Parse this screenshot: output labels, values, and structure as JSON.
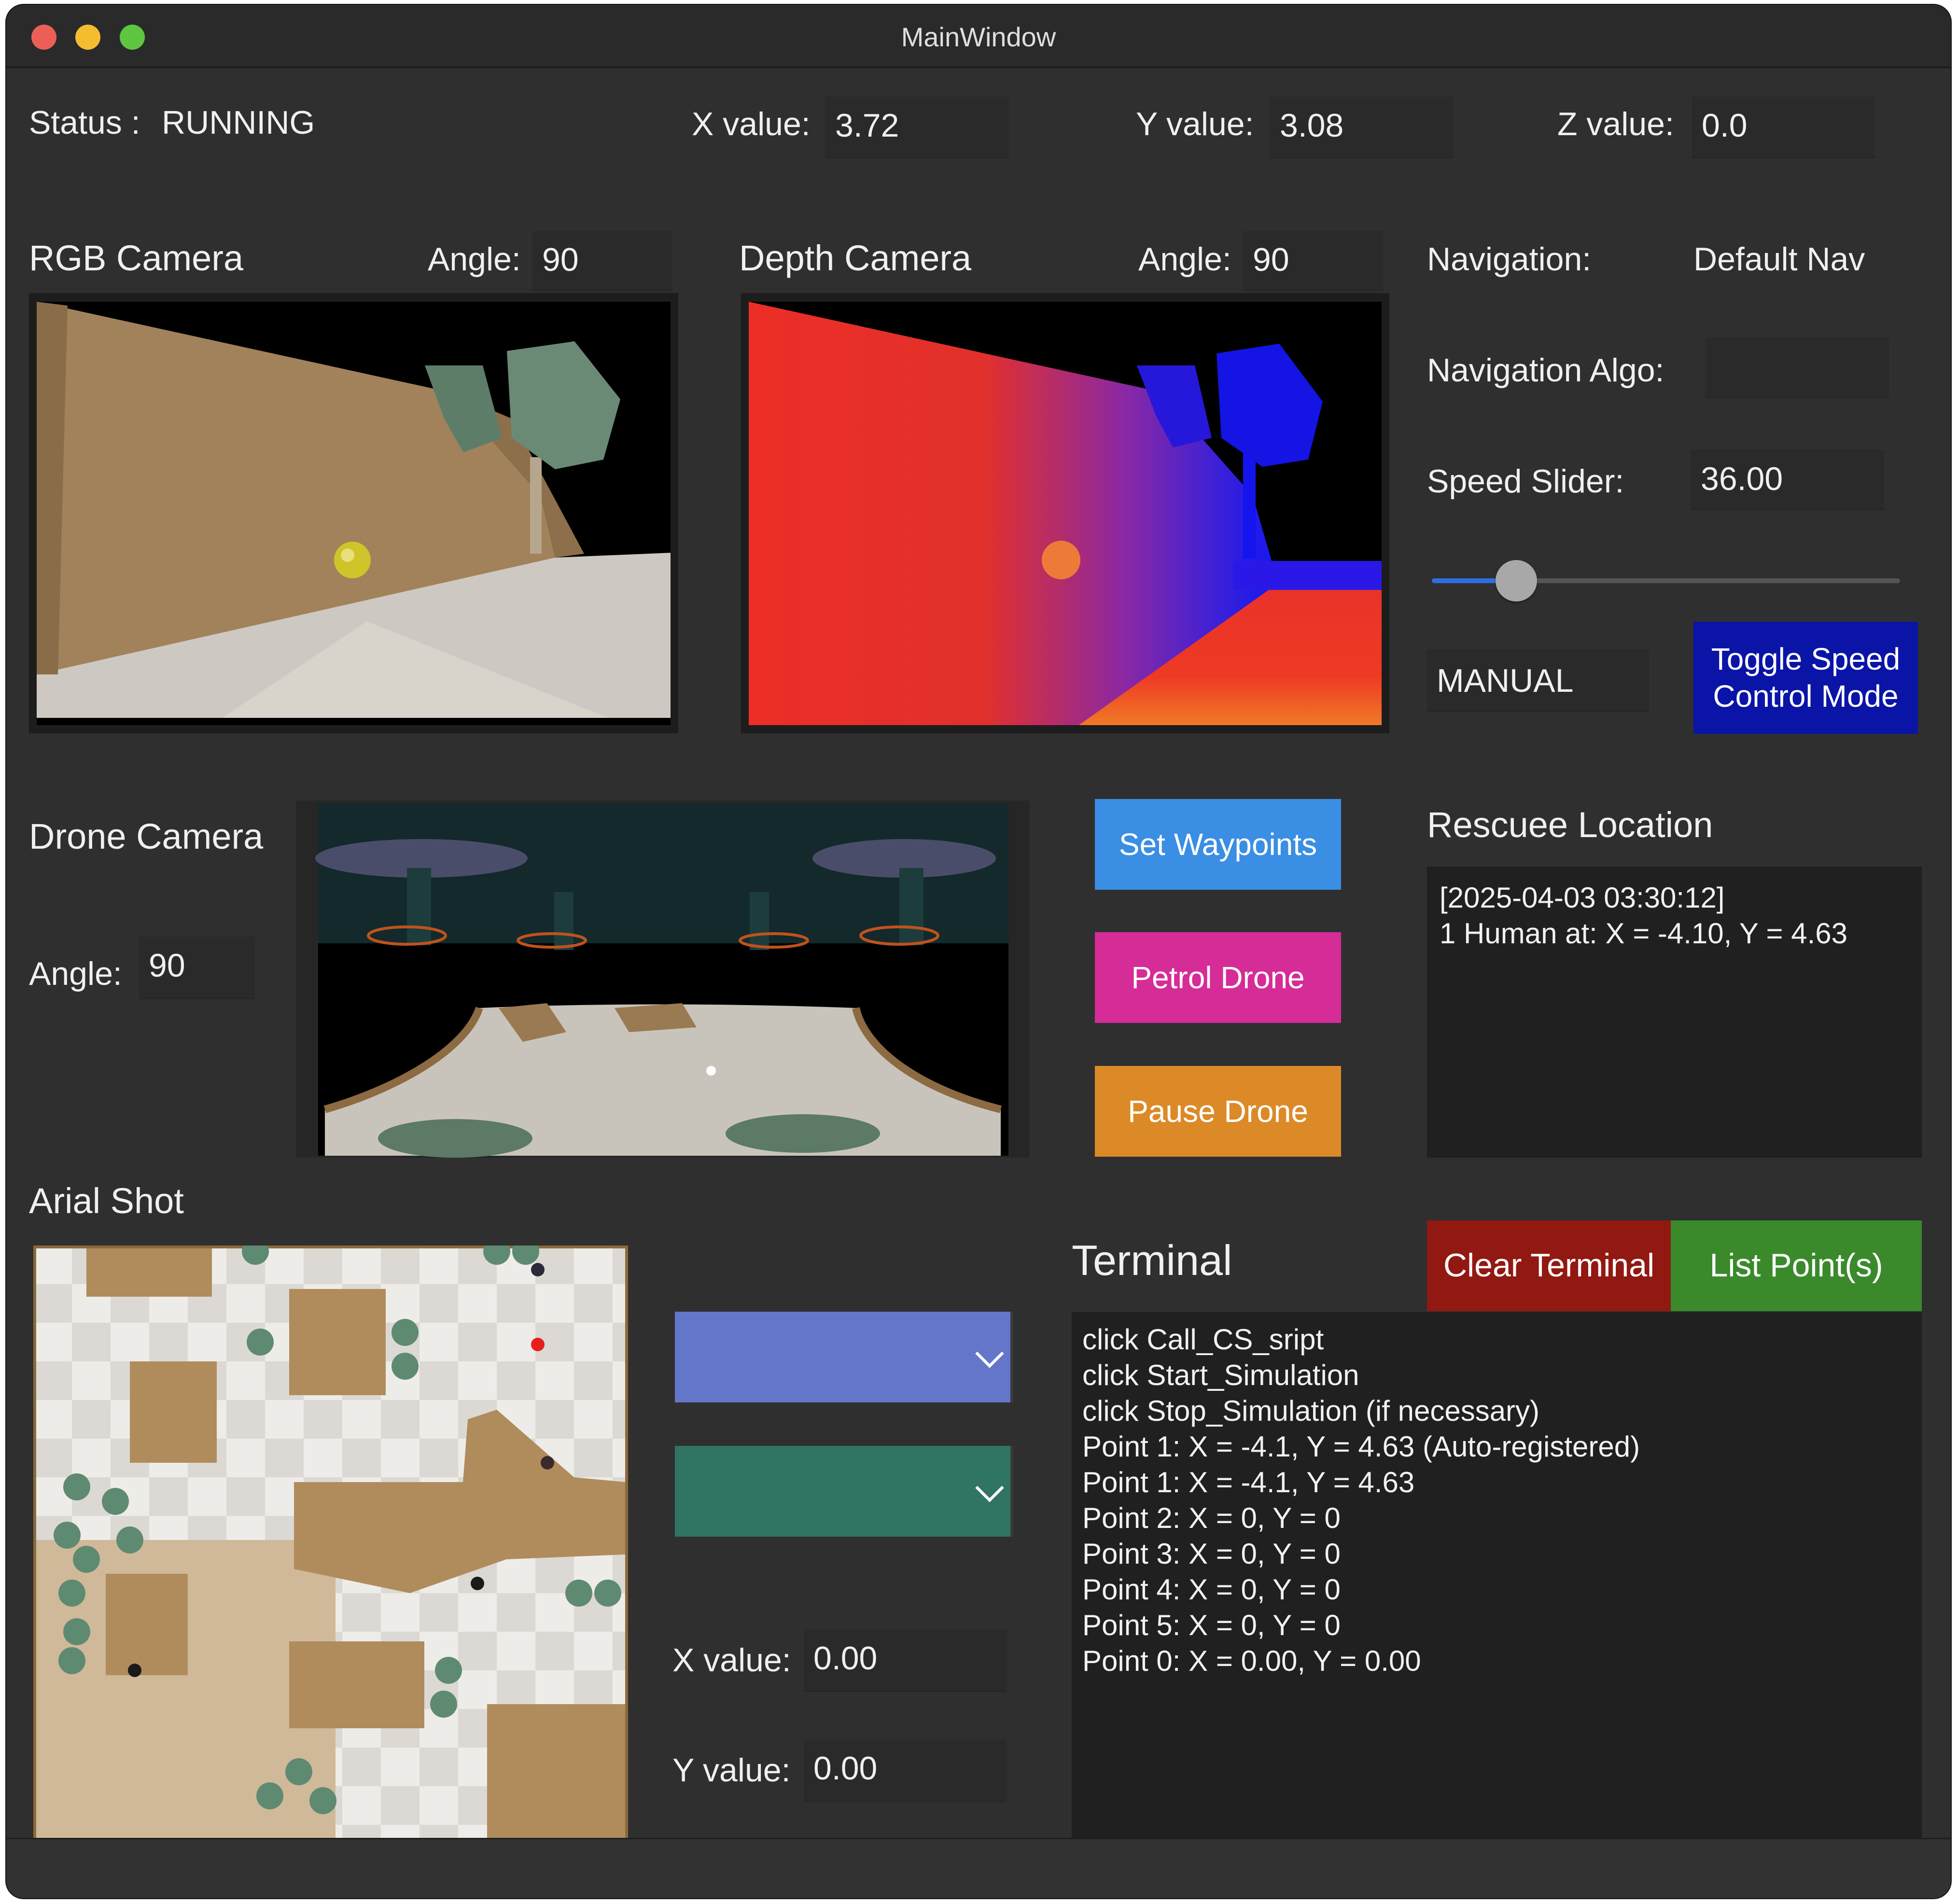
{
  "window": {
    "title": "MainWindow"
  },
  "status": {
    "label": "Status :",
    "value": "RUNNING"
  },
  "position": {
    "x_label": "X value:",
    "x_value": "3.72",
    "y_label": "Y value:",
    "y_value": "3.08",
    "z_label": "Z value:",
    "z_value": "0.0"
  },
  "rgb_camera": {
    "title": "RGB Camera",
    "angle_label": "Angle:",
    "angle_value": "90"
  },
  "depth_camera": {
    "title": "Depth Camera",
    "angle_label": "Angle:",
    "angle_value": "90"
  },
  "drone_camera": {
    "title": "Drone Camera",
    "angle_label": "Angle:",
    "angle_value": "90"
  },
  "navigation": {
    "label": "Navigation:",
    "value": "Default Nav",
    "algo_label": "Navigation Algo:",
    "algo_value": "",
    "speed_label": "Speed Slider:",
    "speed_value": "36.00",
    "speed_fraction": 0.18,
    "mode_value": "MANUAL",
    "toggle_label": "Toggle Speed Control Mode"
  },
  "actions": {
    "set_waypoints": "Set Waypoints",
    "petrol_drone": "Petrol Drone",
    "pause_drone": "Pause Drone"
  },
  "rescuee": {
    "title": "Rescuee Location",
    "text": "[2025-04-03 03:30:12]\n1 Human at: X = -4.10, Y = 4.63"
  },
  "aerial": {
    "title": "Arial Shot"
  },
  "dropdowns": {
    "first_value": "",
    "second_value": ""
  },
  "waypoint": {
    "x_label": "X value:",
    "x_value": "0.00",
    "y_label": "Y value:",
    "y_value": "0.00"
  },
  "terminal": {
    "title": "Terminal",
    "clear_label": "Clear Terminal",
    "list_label": "List Point(s)",
    "lines": "click Call_CS_sript\nclick Start_Simulation\nclick Stop_Simulation (if necessary)\nPoint 1: X = -4.1, Y = 4.63 (Auto-registered)\nPoint 1: X = -4.1, Y = 4.63\nPoint 2: X = 0, Y = 0\nPoint 3: X = 0, Y = 0\nPoint 4: X = 0, Y = 0\nPoint 5: X = 0, Y = 0\nPoint 0: X = 0.00, Y = 0.00"
  },
  "colors": {
    "set_waypoints": "#3a8ee3",
    "petrol_drone": "#d52c97",
    "pause_drone": "#dc8a28",
    "toggle_speed": "#0a14a6",
    "clear_terminal": "#921812",
    "list_points": "#3a8a2c",
    "combo_blue": "#6476c9",
    "combo_green": "#307463"
  }
}
